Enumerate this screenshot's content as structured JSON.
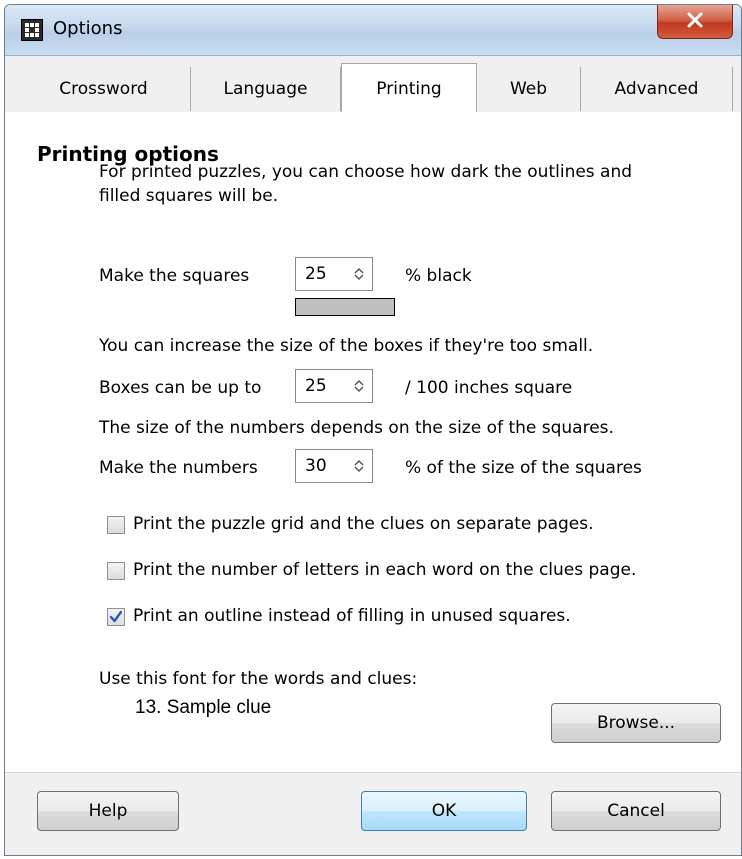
{
  "window": {
    "title": "Options"
  },
  "tabs": [
    {
      "label": "Crossword"
    },
    {
      "label": "Language"
    },
    {
      "label": "Printing"
    },
    {
      "label": "Web"
    },
    {
      "label": "Advanced"
    }
  ],
  "active_tab": "Printing",
  "printing": {
    "heading": "Printing options",
    "intro_line1": "For printed puzzles, you can choose how dark the outlines and",
    "intro_line2": "filled squares will be.",
    "squares_label": "Make the squares",
    "squares_value": "25",
    "squares_suffix": "% black",
    "swatch_color": "#bfbfbf",
    "box_note": "You can increase the size of the boxes if they're too small.",
    "boxes_label": "Boxes can be up to",
    "boxes_value": "25",
    "boxes_suffix": "/ 100 inches square",
    "numbers_note": "The size of the numbers depends on the size of the squares.",
    "numbers_label": "Make the numbers",
    "numbers_value": "30",
    "numbers_suffix": "% of the size of the squares",
    "options": [
      {
        "label": "Print the puzzle grid and the clues on separate pages.",
        "checked": false
      },
      {
        "label": "Print the number of letters in each word on the clues page.",
        "checked": false
      },
      {
        "label": "Print an outline instead of filling in unused squares.",
        "checked": true
      }
    ],
    "font_label": "Use this font for the words and clues:",
    "font_sample": "13. Sample clue",
    "browse_label": "Browse..."
  },
  "footer": {
    "help_label": "Help",
    "ok_label": "OK",
    "cancel_label": "Cancel"
  },
  "colors": {
    "titlebar": "#c5d8ee",
    "close_button": "#c0391f",
    "check_mark": "#2a5db0"
  },
  "icons": {
    "app": "crossword-grid-icon",
    "close": "close-x-icon",
    "spin_up": "chevron-up-icon",
    "spin_down": "chevron-down-icon",
    "check": "checkmark-icon"
  }
}
